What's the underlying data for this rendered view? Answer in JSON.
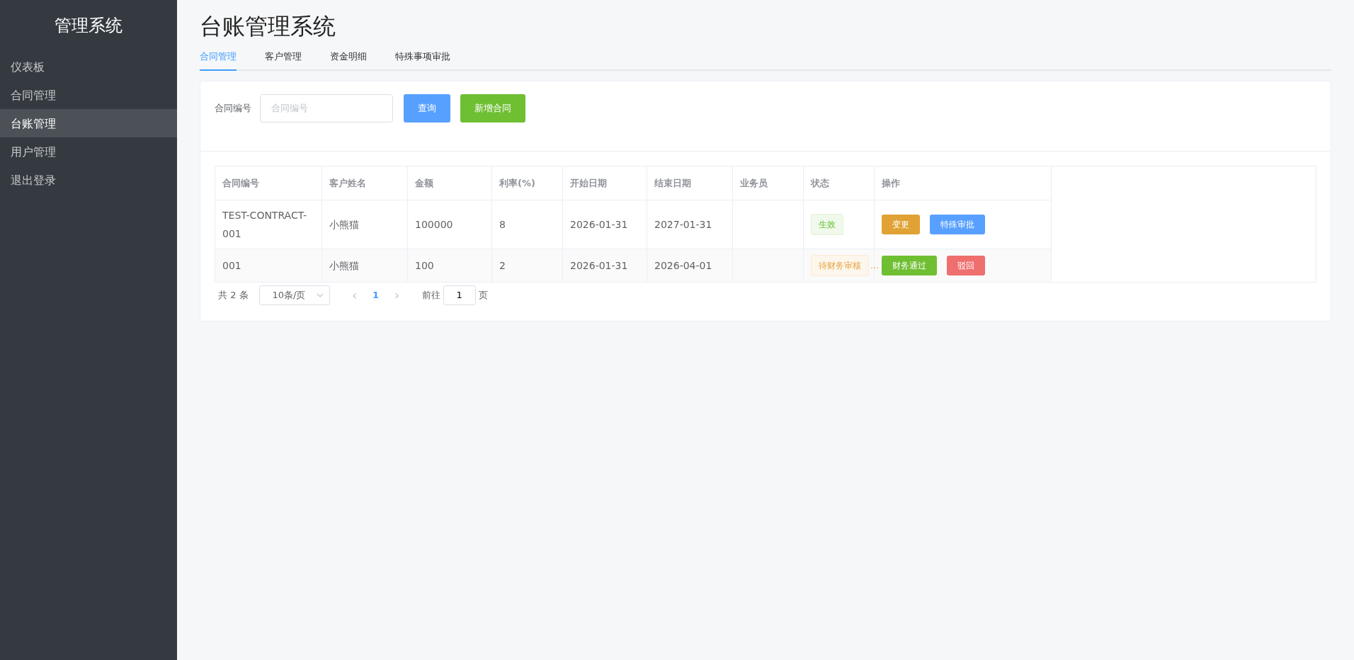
{
  "sidebar": {
    "title": "管理系统",
    "items": [
      {
        "label": "仪表板",
        "selected": false
      },
      {
        "label": "合同管理",
        "selected": false
      },
      {
        "label": "台账管理",
        "selected": true
      },
      {
        "label": "用户管理",
        "selected": false
      },
      {
        "label": "退出登录",
        "selected": false
      }
    ]
  },
  "page_title": "台账管理系统",
  "tabs": [
    {
      "label": "合同管理",
      "selected": true
    },
    {
      "label": "客户管理",
      "selected": false
    },
    {
      "label": "资金明细",
      "selected": false
    },
    {
      "label": "特殊事项审批",
      "selected": false
    }
  ],
  "filter": {
    "label": "合同编号",
    "placeholder": "合同编号",
    "buttons": [
      {
        "label": "查询",
        "kind": "primary"
      },
      {
        "label": "新增合同",
        "kind": "success"
      }
    ]
  },
  "table": {
    "columns": [
      "合同编号",
      "客户姓名",
      "金额",
      "利率(%)",
      "开始日期",
      "结束日期",
      "业务员",
      "状态",
      "操作"
    ],
    "rows": [
      {
        "cells": [
          "TEST-CONTRACT-001",
          "小熊猫",
          "100000",
          "8",
          "2026-01-31",
          "2027-01-31"
        ],
        "status": {
          "text": "生效",
          "kind": "success"
        },
        "actions": [
          {
            "label": "变更",
            "kind": "warning"
          },
          {
            "label": "特殊审批",
            "kind": "primary"
          }
        ]
      },
      {
        "cells": [
          "001",
          "小熊猫",
          "100",
          "2",
          "2026-01-31",
          "2026-04-01"
        ],
        "status": {
          "text": "待财务审核",
          "kind": "warning",
          "ellipsis": "…"
        },
        "actions": [
          {
            "label": "财务通过",
            "kind": "success"
          },
          {
            "label": "驳回",
            "kind": "danger"
          }
        ]
      }
    ]
  },
  "pagination": {
    "total": "共 2 条",
    "page_size": "10条/页",
    "prev": "‹",
    "pages": [
      {
        "label": "1",
        "selected": true
      }
    ],
    "next": "›",
    "goto_label": "前往",
    "goto_value": "1",
    "goto_suffix": "页"
  }
}
